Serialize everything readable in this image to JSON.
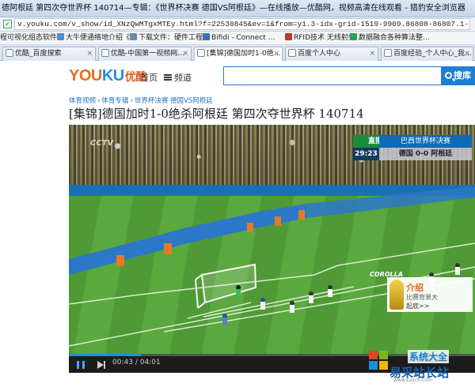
{
  "window": {
    "title": "德阿根廷 第四次夺世界杯 140714—专辑：《世界杯决赛 德国VS阿根廷》—在线播放—优酷网，视频高清在线观看 - 猎豹安全浏览器"
  },
  "address": {
    "url": "v.youku.com/v_show/id_XNzQwMTgxMTEy.html?f=22530845&ev=1&from=y1.3-idx-grid-1519-9909.86808-86807.1-1"
  },
  "bookmarks": [
    {
      "label": "程可视化组态软件…",
      "icon_color": "#5b7fb0"
    },
    {
      "label": "大牛便通络地介绍《…",
      "icon_color": "#4a8fd6"
    },
    {
      "label": "下载文件：硬件工程…",
      "icon_color": "#6d86a8"
    },
    {
      "label": "Bifidi - Connect …",
      "icon_color": "#3d6fb8"
    },
    {
      "label": "RFID技术 无线射频…",
      "icon_color": "#c0392b"
    },
    {
      "label": "数据融合各种算法整…",
      "icon_color": "#2f9f5a"
    }
  ],
  "tabs": [
    {
      "label": "优酷_百度搜索",
      "icon": "paw-icon"
    },
    {
      "label": "优酷-中国第一视频网…",
      "icon": "play-icon"
    },
    {
      "label": "[集锦]德国加时1-0绝…",
      "icon": "play-icon",
      "active": true
    },
    {
      "label": "百度个人中心",
      "icon": "baidu-icon"
    },
    {
      "label": "百度经验_个人中心_我…",
      "icon": "baidu-icon"
    }
  ],
  "site": {
    "logo_you": "YOU",
    "logo_ku": "KU",
    "logo_cn": "优酷",
    "nav_home": "首页",
    "nav_channel": "频道",
    "search_placeholder": "",
    "search_button": "搜库"
  },
  "breadcrumb": [
    "体育视频",
    "体育专辑",
    "世界杯决赛 德国VS阿根廷"
  ],
  "video": {
    "title": "[集锦]德国加时1-0绝杀阿根廷 第四次夺世界杯 140714"
  },
  "overlay": {
    "live_label": "直播",
    "event": "巴西世界杯决赛",
    "clock": "29:23",
    "score": "德国 0-0 阿根廷",
    "channel_logo": "CCTV",
    "sponsor": "COROLLA",
    "promo_title": "介绍",
    "promo_sub": "比赛背景大",
    "promo_more": "起底>>"
  },
  "player": {
    "current_time": "00:43",
    "total_time": "04:01",
    "time_separator": "/",
    "progress": 0.178
  },
  "watermark": {
    "line1": "系统大全",
    "line2": "易采站长站",
    "line3": "www.Easck.Com"
  },
  "colors": {
    "accent": "#1d8fe0",
    "youku_orange": "#ea6d20",
    "link": "#1d6fc4"
  }
}
